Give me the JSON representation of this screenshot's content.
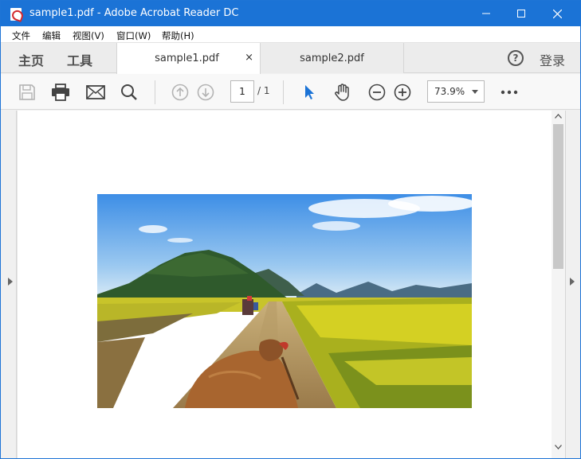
{
  "window": {
    "title": "sample1.pdf - Adobe Acrobat Reader DC"
  },
  "menu": {
    "items": [
      {
        "label": "文件"
      },
      {
        "label": "编辑"
      },
      {
        "label": "视图(V)"
      },
      {
        "label": "窗口(W)"
      },
      {
        "label": "帮助(H)"
      }
    ]
  },
  "tabbar": {
    "home_label": "主页",
    "tools_label": "工具",
    "tabs": [
      {
        "label": "sample1.pdf",
        "close": "×"
      },
      {
        "label": "sample2.pdf"
      }
    ],
    "help_label": "?",
    "login_label": "登录"
  },
  "toolbar": {
    "page_current": "1",
    "page_total": "/ 1",
    "zoom": "73.9%",
    "icons": [
      "save-icon",
      "print-icon",
      "email-icon",
      "search-icon",
      "prev-page-icon",
      "next-page-icon",
      "select-cursor-icon",
      "hand-tool-icon",
      "zoom-out-icon",
      "zoom-in-icon",
      "more-icon"
    ]
  },
  "colors": {
    "titlebar": "#1b73d6",
    "accent": "#1b73d6"
  }
}
